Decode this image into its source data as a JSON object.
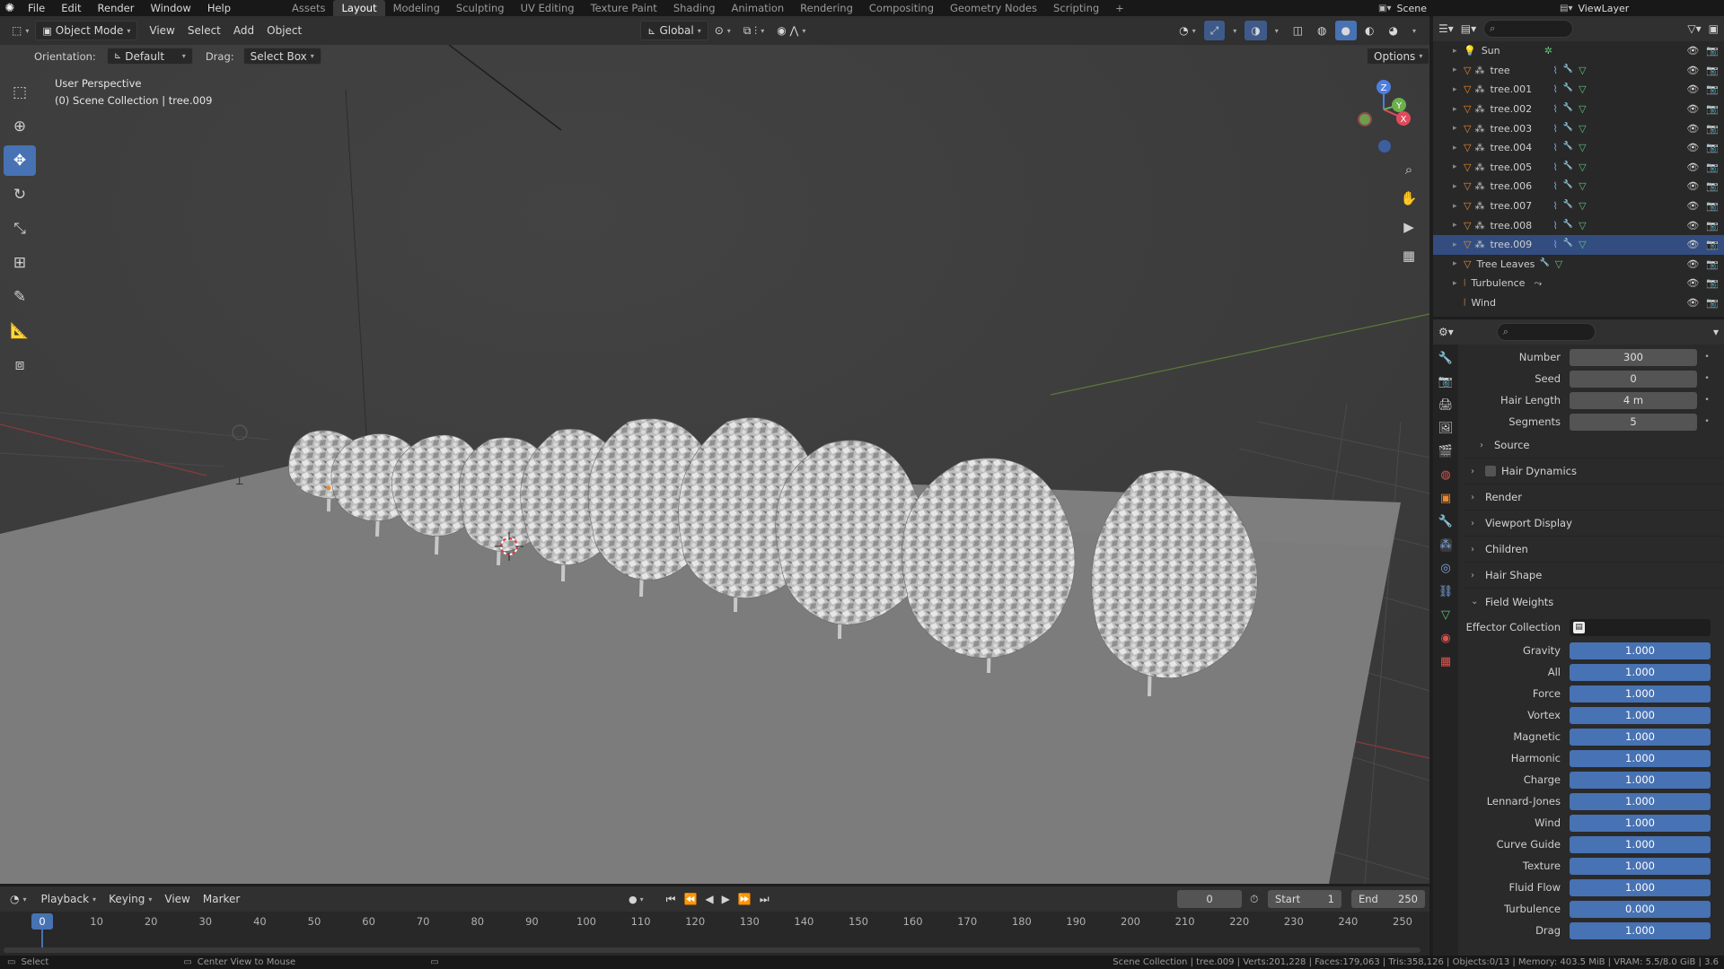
{
  "topbar": {
    "menus": [
      "File",
      "Edit",
      "Render",
      "Window",
      "Help"
    ],
    "workspaces": [
      "Assets",
      "Layout",
      "Modeling",
      "Sculpting",
      "UV Editing",
      "Texture Paint",
      "Shading",
      "Animation",
      "Rendering",
      "Compositing",
      "Geometry Nodes",
      "Scripting"
    ],
    "active_workspace": "Layout",
    "add_tab": "+",
    "scene": "Scene",
    "view_layer": "ViewLayer"
  },
  "viewport_header": {
    "mode": "Object Mode",
    "menus": [
      "View",
      "Select",
      "Add",
      "Object"
    ],
    "transform_orientation": "Global",
    "options": "Options"
  },
  "tool_settings": {
    "orientation_label": "Orientation:",
    "orientation_value": "Default",
    "drag_label": "Drag:",
    "drag_value": "Select Box"
  },
  "viewport": {
    "view_name": "User Perspective",
    "collection_info": "(0) Scene Collection | tree.009",
    "gizmo_axes": [
      "X",
      "Y",
      "Z"
    ]
  },
  "outliner": {
    "rows": [
      {
        "name": "Sun",
        "type": "light"
      },
      {
        "name": "tree",
        "type": "mesh"
      },
      {
        "name": "tree.001",
        "type": "mesh"
      },
      {
        "name": "tree.002",
        "type": "mesh"
      },
      {
        "name": "tree.003",
        "type": "mesh"
      },
      {
        "name": "tree.004",
        "type": "mesh"
      },
      {
        "name": "tree.005",
        "type": "mesh"
      },
      {
        "name": "tree.006",
        "type": "mesh"
      },
      {
        "name": "tree.007",
        "type": "mesh"
      },
      {
        "name": "tree.008",
        "type": "mesh"
      },
      {
        "name": "tree.009",
        "type": "mesh",
        "selected": true
      },
      {
        "name": "Tree Leaves",
        "type": "mesh"
      },
      {
        "name": "Turbulence",
        "type": "force"
      },
      {
        "name": "Wind",
        "type": "force"
      }
    ]
  },
  "properties": {
    "emission": [
      {
        "label": "Number",
        "value": "300"
      },
      {
        "label": "Seed",
        "value": "0"
      },
      {
        "label": "Hair Length",
        "value": "4 m"
      },
      {
        "label": "Segments",
        "value": "5"
      }
    ],
    "panels": [
      "Source",
      "Hair Dynamics",
      "Render",
      "Viewport Display",
      "Children",
      "Hair Shape",
      "Field Weights"
    ],
    "effector_collection_label": "Effector Collection",
    "field_weights": [
      {
        "label": "Gravity",
        "value": "1.000"
      },
      {
        "label": "All",
        "value": "1.000"
      },
      {
        "label": "Force",
        "value": "1.000"
      },
      {
        "label": "Vortex",
        "value": "1.000"
      },
      {
        "label": "Magnetic",
        "value": "1.000"
      },
      {
        "label": "Harmonic",
        "value": "1.000"
      },
      {
        "label": "Charge",
        "value": "1.000"
      },
      {
        "label": "Lennard-Jones",
        "value": "1.000"
      },
      {
        "label": "Wind",
        "value": "1.000"
      },
      {
        "label": "Curve Guide",
        "value": "1.000"
      },
      {
        "label": "Texture",
        "value": "1.000"
      },
      {
        "label": "Fluid Flow",
        "value": "1.000"
      },
      {
        "label": "Turbulence",
        "value": "0.000"
      },
      {
        "label": "Drag",
        "value": "1.000"
      }
    ]
  },
  "timeline": {
    "menus": [
      "Playback",
      "Keying",
      "View",
      "Marker"
    ],
    "current_frame": "0",
    "start_label": "Start",
    "start_value": "1",
    "end_label": "End",
    "end_value": "250",
    "ticks": [
      "0",
      "10",
      "20",
      "30",
      "40",
      "50",
      "60",
      "70",
      "80",
      "90",
      "100",
      "110",
      "120",
      "130",
      "140",
      "150",
      "160",
      "170",
      "180",
      "190",
      "200",
      "210",
      "220",
      "230",
      "240",
      "250"
    ]
  },
  "statusbar": {
    "left": "Select",
    "middle": "Center View to Mouse",
    "right": "Scene Collection | tree.009 | Verts:201,228 | Faces:179,063 | Tris:358,126 | Objects:0/13 | Memory: 403.5 MiB | VRAM: 5.5/8.0 GiB | 3.6"
  },
  "colors": {
    "accent": "#4772b3",
    "selection": "#334d80",
    "orange_icon": "#e9892e",
    "green_icon": "#5cc27a"
  }
}
